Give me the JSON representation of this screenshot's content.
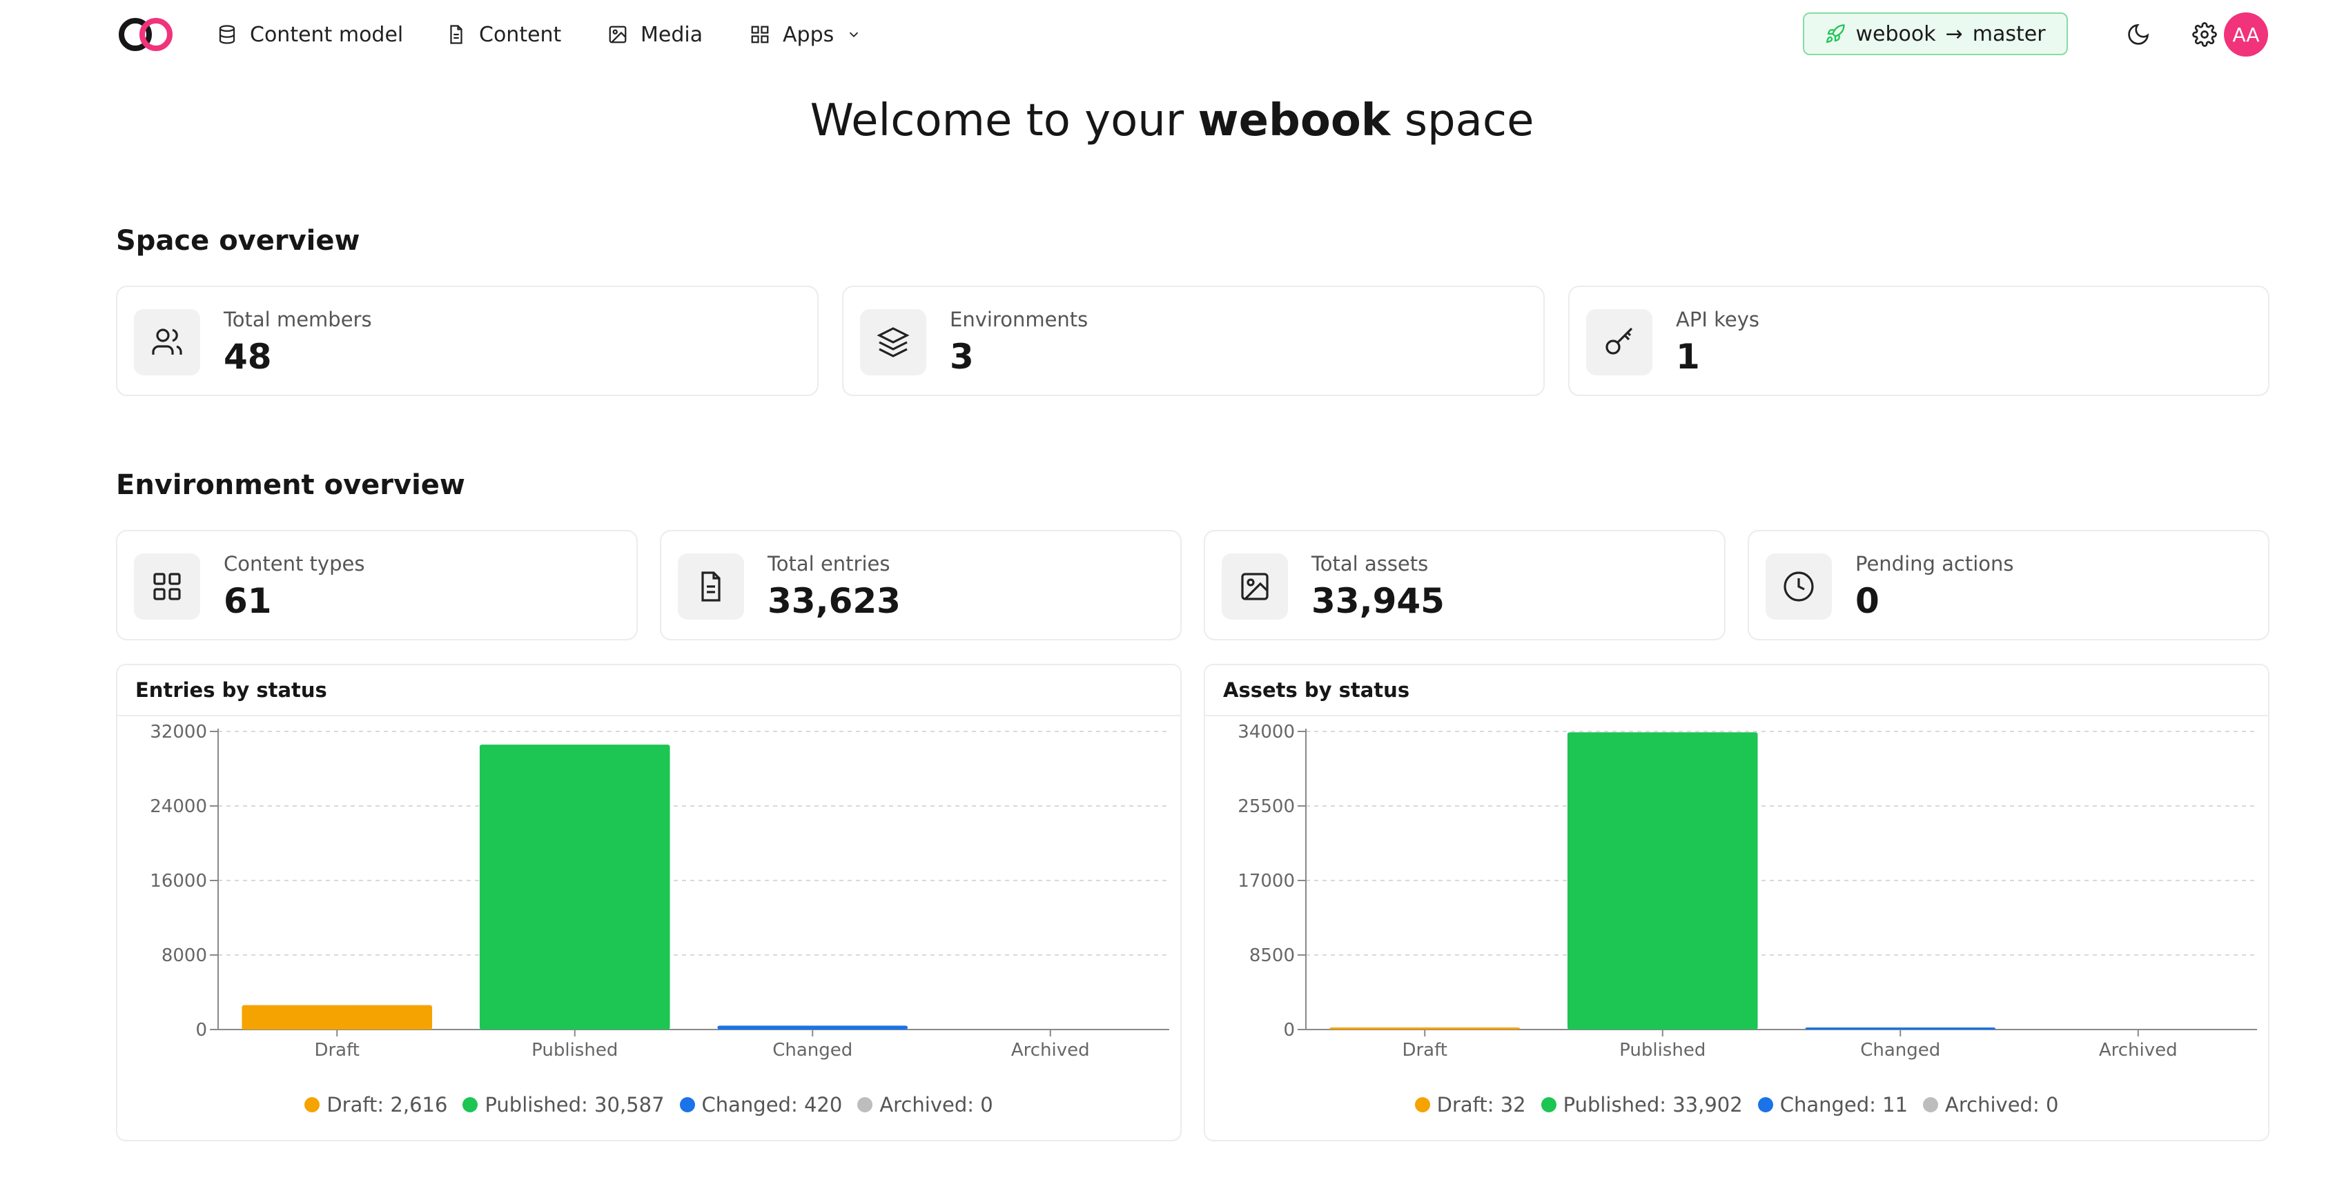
{
  "nav": {
    "items": [
      {
        "label": "Content model",
        "icon": "database-icon"
      },
      {
        "label": "Content",
        "icon": "file-text-icon"
      },
      {
        "label": "Media",
        "icon": "image-icon"
      },
      {
        "label": "Apps",
        "icon": "grid-icon"
      }
    ],
    "environment": {
      "space": "webook",
      "arrow": "→",
      "branch": "master"
    },
    "avatar_initials": "AA"
  },
  "welcome": {
    "prefix": "Welcome to your ",
    "space": "webook",
    "suffix": " space"
  },
  "space_overview": {
    "title": "Space overview",
    "cards": [
      {
        "label": "Total members",
        "value": "48",
        "icon": "users-icon"
      },
      {
        "label": "Environments",
        "value": "3",
        "icon": "layers-icon"
      },
      {
        "label": "API keys",
        "value": "1",
        "icon": "key-icon"
      }
    ]
  },
  "environment_overview": {
    "title": "Environment overview",
    "cards": [
      {
        "label": "Content types",
        "value": "61",
        "icon": "grid-icon"
      },
      {
        "label": "Total entries",
        "value": "33,623",
        "icon": "file-text-icon"
      },
      {
        "label": "Total assets",
        "value": "33,945",
        "icon": "image-icon"
      },
      {
        "label": "Pending actions",
        "value": "0",
        "icon": "clock-icon"
      }
    ]
  },
  "colors": {
    "draft": "#f5a300",
    "published": "#1dc553",
    "changed": "#1a73e8",
    "archived": "#bdbdbd",
    "accent": "#f0337a"
  },
  "chart_data": [
    {
      "type": "bar",
      "title": "Entries by status",
      "categories": [
        "Draft",
        "Published",
        "Changed",
        "Archived"
      ],
      "values": [
        2616,
        30587,
        420,
        0
      ],
      "yticks": [
        0,
        8000,
        16000,
        24000,
        32000
      ],
      "ylim": [
        0,
        32000
      ],
      "grid": true,
      "legend": [
        "Draft: 2,616",
        "Published: 30,587",
        "Changed: 420",
        "Archived: 0"
      ],
      "legend_position": "bottom"
    },
    {
      "type": "bar",
      "title": "Assets by status",
      "categories": [
        "Draft",
        "Published",
        "Changed",
        "Archived"
      ],
      "values": [
        32,
        33902,
        11,
        0
      ],
      "yticks": [
        0,
        8500,
        17000,
        25500,
        34000
      ],
      "ylim": [
        0,
        34000
      ],
      "grid": true,
      "legend": [
        "Draft: 32",
        "Published: 33,902",
        "Changed: 11",
        "Archived: 0"
      ],
      "legend_position": "bottom"
    }
  ]
}
